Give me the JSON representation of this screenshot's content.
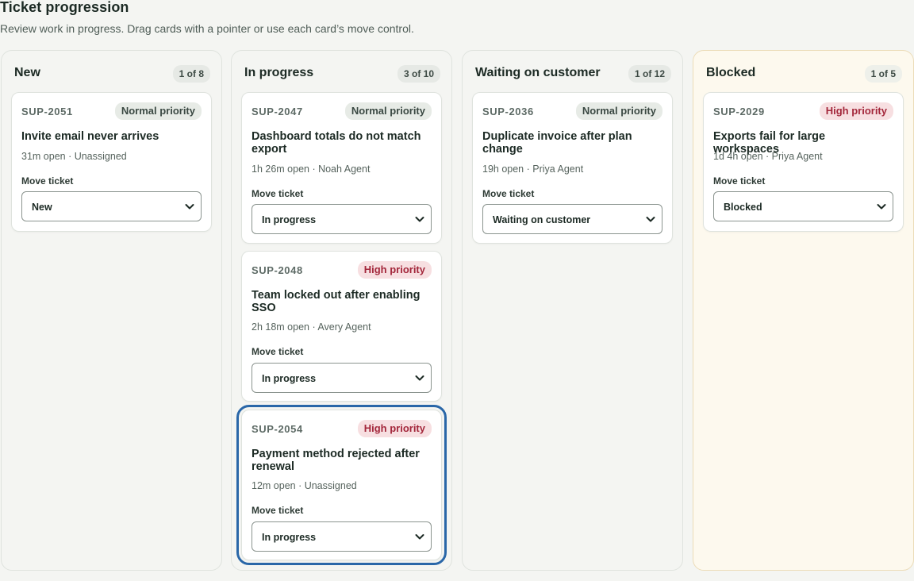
{
  "header": {
    "title": "Ticket progression",
    "subtitle": "Review work in progress. Drag cards with a pointer or use each card’s move control."
  },
  "colors": {
    "high_priority_bg": "#f7dfe1",
    "high_priority_text": "#a3273b",
    "normal_priority_bg": "#e7ebe6",
    "focus_ring": "#2a67a8",
    "blocked_column_bg": "#fdf9ee"
  },
  "columns": [
    {
      "title": "New",
      "count": "1 of 8",
      "cards": [
        {
          "id": "SUP-2051",
          "priority": "Normal priority",
          "title": "Invite email never arrives",
          "meta": "31m open · Unassigned",
          "move_label": "Move ticket",
          "move_value": "New",
          "icon": "chevron-down-icon"
        }
      ]
    },
    {
      "title": "In progress",
      "count": "3 of 10",
      "cards": [
        {
          "id": "SUP-2047",
          "priority": "Normal priority",
          "title": "Dashboard totals do not match export",
          "meta": "1h 26m open · Noah Agent",
          "move_label": "Move ticket",
          "move_value": "In progress"
        },
        {
          "id": "SUP-2048",
          "priority": "High priority",
          "title": "Team locked out after enabling SSO",
          "meta": "2h 18m open · Avery Agent",
          "move_label": "Move ticket",
          "move_value": "In progress"
        },
        {
          "id": "SUP-2054",
          "priority": "High priority",
          "title": "Payment method rejected after renewal",
          "meta": "12m open · Unassigned",
          "move_label": "Move ticket",
          "move_value": "In progress"
        }
      ]
    },
    {
      "title": "Waiting on customer",
      "count": "1 of 12",
      "cards": [
        {
          "id": "SUP-2036",
          "priority": "Normal priority",
          "title": "Duplicate invoice after plan change",
          "meta": "19h open · Priya Agent",
          "move_label": "Move ticket",
          "move_value": "Waiting on customer"
        }
      ]
    },
    {
      "title": "Blocked",
      "count": "1 of 5",
      "cards": [
        {
          "id": "SUP-2029",
          "priority": "High priority",
          "title": "Exports fail for large workspaces",
          "meta": "1d 4h open · Priya Agent",
          "move_label": "Move ticket",
          "move_value": "Blocked"
        }
      ]
    }
  ]
}
